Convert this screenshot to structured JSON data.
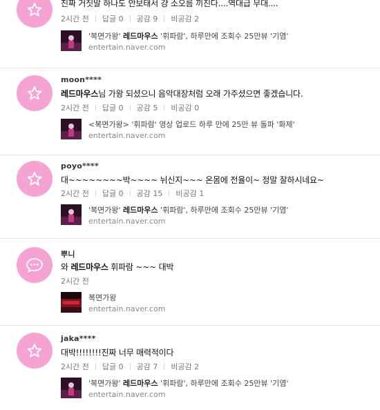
{
  "comments": [
    {
      "nick": "",
      "body_plain": "진짜 거짓말 하나도 안보태서 걍 소오름 끼친다....역대급 무대....",
      "avatar_icon": "star-icon",
      "time": "2시간 전",
      "reply_label": "답글",
      "reply_count": "0",
      "like_label": "공감",
      "like_count": "9",
      "dislike_label": "비공감",
      "dislike_count": "2",
      "news": {
        "pre": "'복면가왕' ",
        "bold": "레드마우스",
        "post": " '휘파람', 하루만에 조회수 25만뷰 '기염'",
        "domain": "entertain.naver.com",
        "thumb": "concert"
      }
    },
    {
      "nick": "moon****",
      "body_bold": "레드마우스",
      "body_plain": "님 가왕 되셨으니 음악대장처럼 오래 가주셨으면 좋겠습니다.",
      "avatar_icon": "star-icon",
      "time": "2시간 전",
      "reply_label": "답글",
      "reply_count": "0",
      "like_label": "공감",
      "like_count": "5",
      "dislike_label": "비공감",
      "dislike_count": "0",
      "news": {
        "pre": "<복면가왕> '휘파람' 영상 업로드 하루 만에 25만 뷰 돌파 '화제'",
        "domain": "entertain.naver.com",
        "thumb": "concert"
      }
    },
    {
      "nick": "poyo****",
      "body_plain": "대~~~~~~~~박~~~~ 뉘신지~~~ 온몸에 전율이~ 정말 잘하시네요~",
      "avatar_icon": "star-icon",
      "time": "2시간 전",
      "reply_label": "답글",
      "reply_count": "0",
      "like_label": "공감",
      "like_count": "15",
      "dislike_label": "비공감",
      "dislike_count": "1",
      "news": {
        "pre": "'복면가왕' ",
        "bold": "레드마우스",
        "post": " '휘파람', 하루만에 조회수 25만뷰 '기염'",
        "domain": "entertain.naver.com",
        "thumb": "concert"
      }
    },
    {
      "nick": "뿌니",
      "body_pre": "와 ",
      "body_bold": "레드마우스",
      "body_plain": " 휘파람 ~~~ 대박",
      "avatar_icon": "speech-bubble-icon",
      "time": "2시간 전",
      "news": {
        "pre": "복면가왕",
        "domain": "entertain.naver.com",
        "thumb": "stage"
      }
    },
    {
      "nick": "jaka****",
      "body_plain": "대박!!!!!!!!진짜 너무 매력적이다",
      "avatar_icon": "star-icon",
      "time": "2시간 전",
      "reply_label": "답글",
      "reply_count": "0",
      "like_label": "공감",
      "like_count": "7",
      "dislike_label": "비공감",
      "dislike_count": "2",
      "news": {
        "pre": "'복면가왕' ",
        "bold": "레드마우스",
        "post": " '휘파람', 하루만에 조회수 25만뷰 '기염'",
        "domain": "entertain.naver.com",
        "thumb": "concert"
      }
    }
  ],
  "colors": {
    "avatar_pink": "#f5a3d2",
    "divider": "#e4e4e4",
    "meta": "#777777"
  }
}
